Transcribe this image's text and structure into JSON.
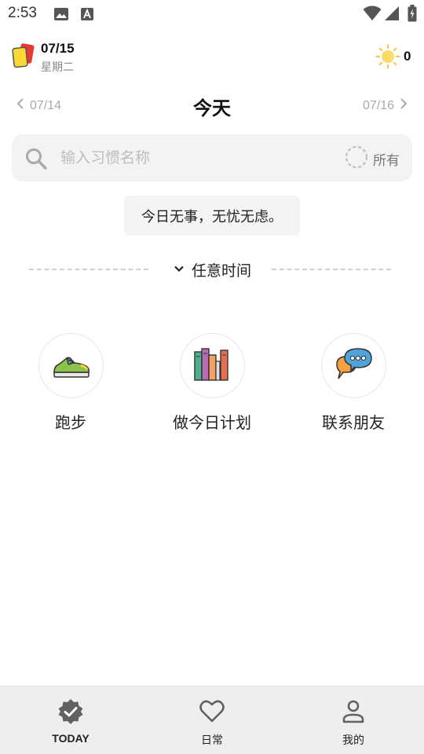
{
  "status_bar": {
    "time": "2:53",
    "icons": [
      "image-icon",
      "a-icon",
      "wifi-icon",
      "signal-icon",
      "battery-icon"
    ]
  },
  "header": {
    "date": "07/15",
    "weekday": "星期二",
    "points": "0"
  },
  "day_nav": {
    "prev_date": "07/14",
    "title": "今天",
    "next_date": "07/16"
  },
  "search": {
    "placeholder": "输入习惯名称",
    "filter_label": "所有"
  },
  "tip": "今日无事，无忧无虑。",
  "section": {
    "label": "任意时间"
  },
  "habits": [
    {
      "label": "跑步",
      "icon": "sneaker-icon"
    },
    {
      "label": "做今日计划",
      "icon": "books-icon"
    },
    {
      "label": "联系朋友",
      "icon": "chat-bubbles-icon"
    }
  ],
  "bottom_nav": {
    "items": [
      {
        "label": "TODAY",
        "icon": "badge-check-icon",
        "active": true
      },
      {
        "label": "日常",
        "icon": "heart-icon",
        "active": false
      },
      {
        "label": "我的",
        "icon": "user-icon",
        "active": false
      }
    ]
  },
  "colors": {
    "search_bg": "#f3f3f3",
    "sun": "#f9c74f",
    "nav_bg": "#eeeeee"
  }
}
